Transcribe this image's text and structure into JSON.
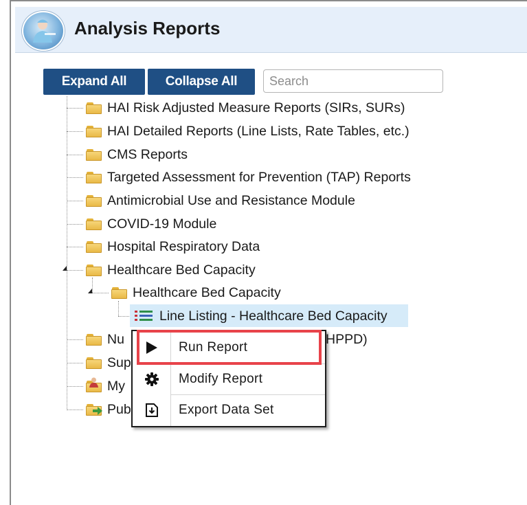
{
  "header": {
    "title": "Analysis Reports",
    "logo_icon": "nurse-logo-icon"
  },
  "toolbar": {
    "expand_label": "Expand All",
    "collapse_label": "Collapse All",
    "search_placeholder": "Search"
  },
  "tree": {
    "items": [
      {
        "label": "HAI Risk Adjusted Measure Reports (SIRs, SURs)",
        "icon": "folder-icon"
      },
      {
        "label": "HAI Detailed Reports (Line Lists, Rate Tables, etc.)",
        "icon": "folder-icon"
      },
      {
        "label": "CMS Reports",
        "icon": "folder-icon"
      },
      {
        "label": "Targeted Assessment for Prevention (TAP) Reports",
        "icon": "folder-icon"
      },
      {
        "label": "Antimicrobial Use and Resistance Module",
        "icon": "folder-icon"
      },
      {
        "label": "COVID-19 Module",
        "icon": "folder-icon"
      },
      {
        "label": "Hospital Respiratory Data",
        "icon": "folder-icon"
      },
      {
        "label": "Healthcare Bed Capacity",
        "icon": "folder-open-icon",
        "expanded": true
      },
      {
        "label": "Healthcare Bed Capacity",
        "icon": "folder-open-icon",
        "expanded": true
      },
      {
        "label": "Line Listing - Healthcare Bed Capacity",
        "icon": "list-report-icon",
        "selected": true
      },
      {
        "label": "Nu",
        "label_suffix": "HPPD)",
        "icon": "folder-icon"
      },
      {
        "label": "Sup",
        "icon": "folder-icon"
      },
      {
        "label": "My",
        "icon": "my-reports-folder-icon"
      },
      {
        "label": "Pub",
        "icon": "published-folder-icon"
      }
    ]
  },
  "context_menu": {
    "items": [
      {
        "label": "Run Report",
        "icon": "play-icon"
      },
      {
        "label": "Modify Report",
        "icon": "gear-icon"
      },
      {
        "label": "Export Data Set",
        "icon": "export-icon"
      }
    ],
    "highlight_color": "#e8434a"
  },
  "colors": {
    "button_bg": "#1f4f84",
    "header_bg": "#e6effa",
    "selected_bg": "#d6ebf9"
  }
}
